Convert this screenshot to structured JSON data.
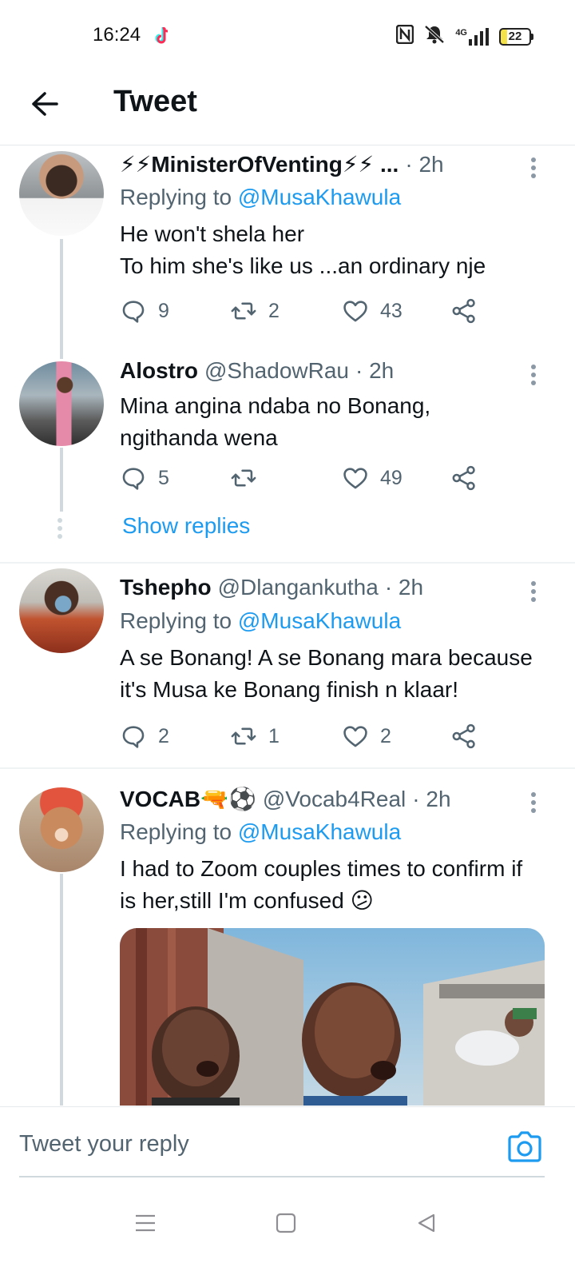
{
  "status_bar": {
    "time": "16:24",
    "network": "4G",
    "battery": "22"
  },
  "header": {
    "title": "Tweet"
  },
  "tweets": [
    {
      "name": "⚡⚡MinisterOfVenting⚡⚡ ...",
      "handle": "",
      "time": "· 2h",
      "replying_label": "Replying to",
      "replying_to": "@MusaKhawula",
      "text_lines": [
        "He won't shela her",
        "To him she's like us ...an ordinary nje"
      ],
      "replies": "9",
      "retweets": "2",
      "likes": "43"
    },
    {
      "name": "Alostro",
      "handle": "@ShadowRau",
      "time": "· 2h",
      "text_lines": [
        "Mina angina ndaba no Bonang,",
        "ngithanda wena"
      ],
      "replies": "5",
      "retweets": "",
      "likes": "49",
      "show_replies": "Show replies"
    },
    {
      "name": "Tshepho",
      "handle": "@Dlangankutha",
      "time": "· 2h",
      "replying_label": "Replying to",
      "replying_to": "@MusaKhawula",
      "text_lines": [
        "A se Bonang! A se Bonang mara because",
        "it's Musa ke Bonang finish n klaar!"
      ],
      "replies": "2",
      "retweets": "1",
      "likes": "2"
    },
    {
      "name": "VOCAB🔫⚽",
      "handle": "@Vocab4Real",
      "time": "· 2h",
      "replying_label": "Replying to",
      "replying_to": "@MusaKhawula",
      "text_lines": [
        "I had to Zoom couples times to confirm if",
        "is her,still I'm confused 😕"
      ]
    }
  ],
  "reply_bar": {
    "placeholder": "Tweet your reply"
  },
  "icons": {
    "reply": "reply-icon",
    "retweet": "retweet-icon",
    "like": "heart-icon",
    "share": "share-icon",
    "camera": "camera-icon"
  },
  "colors": {
    "accent": "#1d9bf0",
    "secondary_text": "#536471",
    "primary_text": "#0f1419"
  }
}
